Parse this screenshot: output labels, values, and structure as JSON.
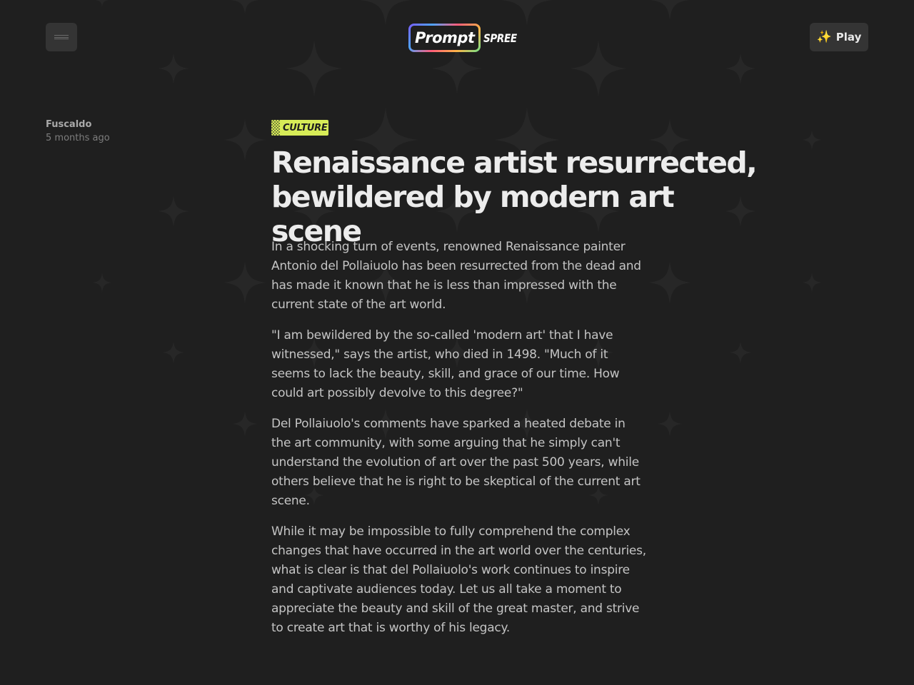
{
  "header": {
    "menu_icon": "hamburger-icon",
    "logo": {
      "word1": "Prompt",
      "word2": "SPREE"
    },
    "play_button": {
      "icon": "sparkles-icon",
      "label": "Play"
    }
  },
  "article": {
    "author": "Fuscaldo",
    "time_ago": "5 months ago",
    "category": "CULTURE",
    "title": "Renaissance artist resurrected, bewildered by modern art scene",
    "paragraphs": [
      "In a shocking turn of events, renowned Renaissance painter Antonio del Pollaiuolo has been resurrected from the dead and has made it known that he is less than impressed with the current state of the art world.",
      "\"I am bewildered by the so-called 'modern art' that I have witnessed,\" says the artist, who died in 1498. \"Much of it seems to lack the beauty, skill, and grace of our time. How could art possibly devolve to this degree?\"",
      "Del Pollaiuolo's comments have sparked a heated debate in the art community, with some arguing that he simply can't understand the evolution of art over the past 500 years, while others believe that he is right to be skeptical of the current art scene.",
      "While it may be impossible to fully comprehend the complex changes that have occurred in the art world over the centuries, what is clear is that del Pollaiuolo's work continues to inspire and captivate audiences today. Let us all take a moment to appreciate the beauty and skill of the great master, and strive to create art that is worthy of his legacy."
    ]
  },
  "colors": {
    "background": "#1f1f1f",
    "badge": "#d7ec57",
    "sparkle": "#f7c94a"
  }
}
